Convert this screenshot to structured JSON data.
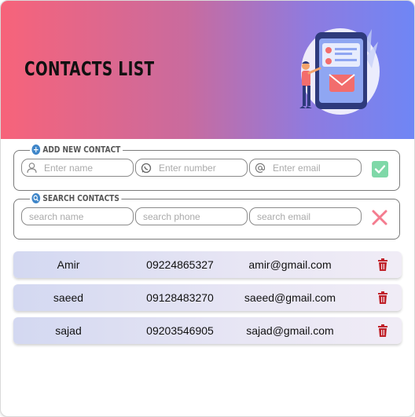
{
  "header": {
    "title": "CONTACTS LIST",
    "gradient_start": "#f7637a",
    "gradient_end": "#6f86f5"
  },
  "add_contact": {
    "legend": "ADD NEW CONTACT",
    "legend_icon": "plus-circle-icon",
    "name_placeholder": "Enter name",
    "number_placeholder": "Enter number",
    "email_placeholder": "Enter email",
    "name_icon": "user-icon",
    "number_icon": "whatsapp-icon",
    "email_icon": "at-sign-icon",
    "submit_icon": "check-square-icon",
    "submit_color": "#7fd8a8"
  },
  "search": {
    "legend": "SEARCH CONTACTS",
    "legend_icon": "search-icon",
    "name_placeholder": "search name",
    "phone_placeholder": "search phone",
    "email_placeholder": "search email",
    "clear_icon": "close-icon",
    "clear_color": "#f47c8f"
  },
  "contacts": [
    {
      "name": "Amir",
      "phone": "09224865327",
      "email": "amir@gmail.com"
    },
    {
      "name": "saeed",
      "phone": "09128483270",
      "email": "saeed@gmail.com"
    },
    {
      "name": "sajad",
      "phone": "09203546905",
      "email": "sajad@gmail.com"
    }
  ],
  "delete_icon": "trash-icon",
  "delete_color": "#c0222a"
}
